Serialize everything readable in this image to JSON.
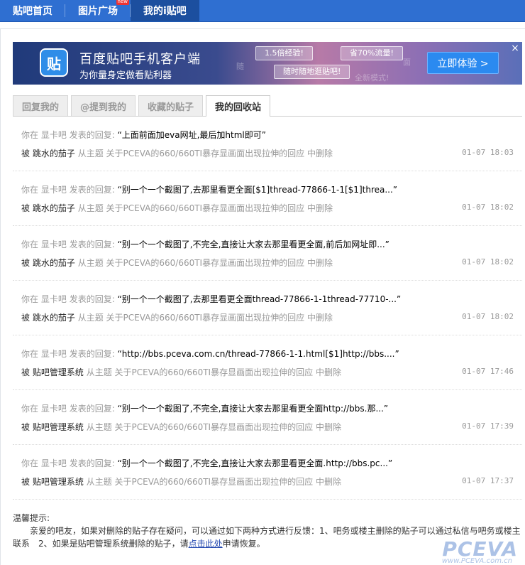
{
  "nav": {
    "items": [
      {
        "label": "贴吧首页",
        "active": false
      },
      {
        "label": "图片广场",
        "active": false,
        "badge": "new"
      },
      {
        "label": "我的i贴吧",
        "active": true
      }
    ]
  },
  "banner": {
    "icon_text": "贴",
    "title": "百度贴吧手机客户端",
    "subtitle": "为你量身定做看贴利器",
    "pills": [
      "1.5倍经验!",
      "省70%流量!",
      "随时随地逛贴吧!"
    ],
    "ghosts": [
      "随",
      "面",
      "全新模式!"
    ],
    "cta": "立即体验 >",
    "close": "×"
  },
  "tabs": [
    {
      "label": "回复我的",
      "active": false
    },
    {
      "label": "@提到我的",
      "active": false
    },
    {
      "label": "收藏的贴子",
      "active": false
    },
    {
      "label": "我的回收站",
      "active": true
    }
  ],
  "rows": [
    {
      "prefix": "你在",
      "forum": "显卡吧",
      "action": "发表的回复:",
      "quote": "“上面前面加eva网址,最后加html即可”",
      "by": "被",
      "user": "跳水的茄子",
      "from": "从主题",
      "topic": "关于PCEVA的660/660TI暴存显画面出现拉伸的回应",
      "deleted": "中删除",
      "time": "01-07 18:03"
    },
    {
      "prefix": "你在",
      "forum": "显卡吧",
      "action": "发表的回复:",
      "quote": "“别一个一个截图了,去那里看更全面[$1]thread-77866-1-1[$1]threa...”",
      "by": "被",
      "user": "跳水的茄子",
      "from": "从主题",
      "topic": "关于PCEVA的660/660TI暴存显画面出现拉伸的回应",
      "deleted": "中删除",
      "time": "01-07 18:02"
    },
    {
      "prefix": "你在",
      "forum": "显卡吧",
      "action": "发表的回复:",
      "quote": "“别一个一个截图了,不完全,直接让大家去那里看更全面,前后加网址即...”",
      "by": "被",
      "user": "跳水的茄子",
      "from": "从主题",
      "topic": "关于PCEVA的660/660TI暴存显画面出现拉伸的回应",
      "deleted": "中删除",
      "time": "01-07 18:02"
    },
    {
      "prefix": "你在",
      "forum": "显卡吧",
      "action": "发表的回复:",
      "quote": "“别一个一个截图了,去那里看更全面thread-77866-1-1thread-77710-...”",
      "by": "被",
      "user": "跳水的茄子",
      "from": "从主题",
      "topic": "关于PCEVA的660/660TI暴存显画面出现拉伸的回应",
      "deleted": "中删除",
      "time": "01-07 18:02"
    },
    {
      "prefix": "你在",
      "forum": "显卡吧",
      "action": "发表的回复:",
      "quote": "“http://bbs.pceva.com.cn/thread-77866-1-1.html[$1]http://bbs....”",
      "by": "被",
      "user": "贴吧管理系统",
      "from": "从主题",
      "topic": "关于PCEVA的660/660TI暴存显画面出现拉伸的回应",
      "deleted": "中删除",
      "time": "01-07 17:46"
    },
    {
      "prefix": "你在",
      "forum": "显卡吧",
      "action": "发表的回复:",
      "quote": "“别一个一个截图了,不完全,直接让大家去那里看更全面http://bbs.那...”",
      "by": "被",
      "user": "贴吧管理系统",
      "from": "从主题",
      "topic": "关于PCEVA的660/660TI暴存显画面出现拉伸的回应",
      "deleted": "中删除",
      "time": "01-07 17:39"
    },
    {
      "prefix": "你在",
      "forum": "显卡吧",
      "action": "发表的回复:",
      "quote": "“别一个一个截图了,不完全,直接让大家去那里看更全面.http://bbs.pc...”",
      "by": "被",
      "user": "贴吧管理系统",
      "from": "从主题",
      "topic": "关于PCEVA的660/660TI暴存显画面出现拉伸的回应",
      "deleted": "中删除",
      "time": "01-07 17:37"
    }
  ],
  "tips": {
    "title": "温馨提示:",
    "body": "亲爱的吧友，如果对删除的贴子存在疑问，可以通过如下两种方式进行反馈：1、吧务或楼主删除的贴子可以通过私信与吧务或楼主联系　2、如果是贴吧管理系统删除的贴子，请",
    "link": "点击此处",
    "tail": "申请恢复。"
  },
  "watermark": {
    "text": "PCEVA",
    "sub": "www.PCEVA.com.cn"
  },
  "colors": {
    "nav_bg": "#2f6fd1",
    "nav_active": "#1c4f9f",
    "cta_bg": "#2b8af0",
    "link": "#2449b0"
  }
}
